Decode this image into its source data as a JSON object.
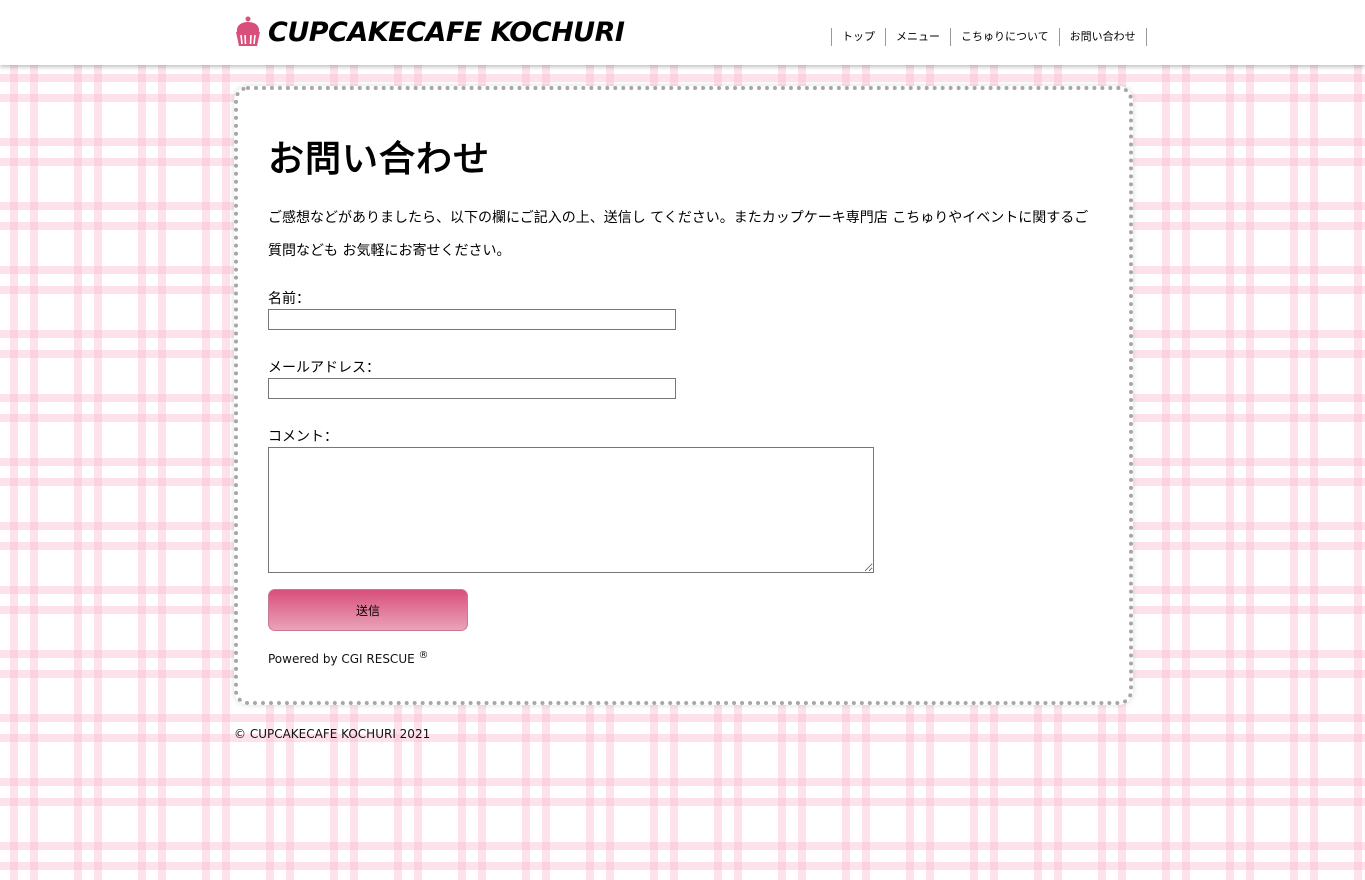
{
  "header": {
    "logo_text": "CUPCAKECAFE KOCHURI",
    "nav": [
      "トップ",
      "メニュー",
      "こちゅりについて",
      "お問い合わせ"
    ]
  },
  "main": {
    "title": "お問い合わせ",
    "intro": "ご感想などがありましたら、以下の欄にご記入の上、送信し てください。またカップケーキ専門店 こちゅりやイベントに関するご質問なども お気軽にお寄せください。",
    "form": {
      "name_label": "名前：",
      "name_value": "",
      "email_label": "メールアドレス：",
      "email_value": "",
      "comment_label": "コメント：",
      "comment_value": "",
      "submit_label": "送信"
    },
    "powered_by": "Powered by CGI RESCUE",
    "registered_mark": "®"
  },
  "footer": {
    "copyright": "© CUPCAKECAFE KOCHURI 2021"
  },
  "colors": {
    "accent": "#d94f7c",
    "accent_light": "#e9a3b8",
    "card_border": "#a6a6a6",
    "plaid": "#fab4cd"
  }
}
